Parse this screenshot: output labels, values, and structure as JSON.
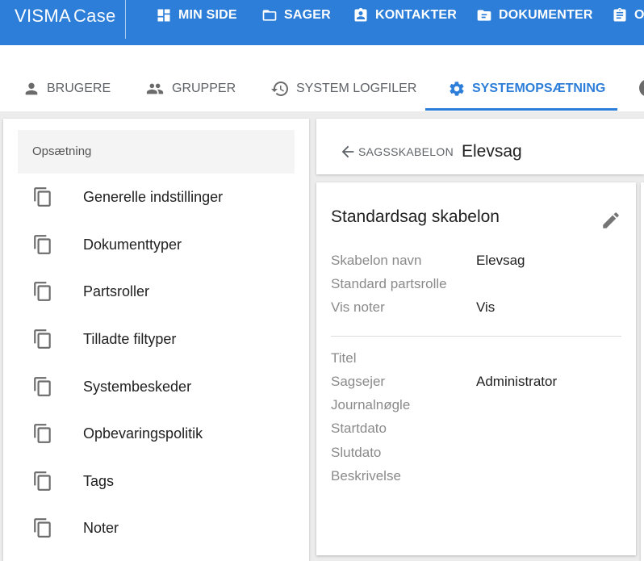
{
  "app": {
    "brand": "VISMA",
    "product": "Case"
  },
  "topnav": [
    {
      "id": "min-side",
      "label": "MIN SIDE",
      "icon": "dashboard-icon"
    },
    {
      "id": "sager",
      "label": "SAGER",
      "icon": "folder-icon"
    },
    {
      "id": "kontakter",
      "label": "KONTAKTER",
      "icon": "contact-card-icon"
    },
    {
      "id": "dokumenter",
      "label": "DOKUMENTER",
      "icon": "document-folder-icon"
    },
    {
      "id": "o",
      "label": "O",
      "icon": "clipboard-icon"
    }
  ],
  "tabs": [
    {
      "id": "brugere",
      "label": "BRUGERE",
      "icon": "person-icon",
      "active": false
    },
    {
      "id": "grupper",
      "label": "GRUPPER",
      "icon": "group-icon",
      "active": false
    },
    {
      "id": "system-logfiler",
      "label": "SYSTEM LOGFILER",
      "icon": "history-icon",
      "active": false
    },
    {
      "id": "systemopsaetning",
      "label": "SYSTEMOPSÆTNING",
      "icon": "gear-icon",
      "active": true
    }
  ],
  "sidebar": {
    "header": "Opsætning",
    "items": [
      {
        "label": "Generelle indstillinger",
        "icon": "copy-icon"
      },
      {
        "label": "Dokumenttyper",
        "icon": "copy-icon"
      },
      {
        "label": "Partsroller",
        "icon": "copy-icon"
      },
      {
        "label": "Tilladte filtyper",
        "icon": "copy-icon"
      },
      {
        "label": "Systembeskeder",
        "icon": "copy-icon"
      },
      {
        "label": "Opbevaringspolitik",
        "icon": "copy-icon"
      },
      {
        "label": "Tags",
        "icon": "copy-icon"
      },
      {
        "label": "Noter",
        "icon": "copy-icon"
      }
    ]
  },
  "header": {
    "back_label": "SAGSSKABELON",
    "title": "Elevsag"
  },
  "detail": {
    "title": "Standardsag skabelon",
    "group1": [
      {
        "label": "Skabelon navn",
        "value": "Elevsag"
      },
      {
        "label": "Standard partsrolle",
        "value": ""
      },
      {
        "label": "Vis noter",
        "value": "Vis"
      }
    ],
    "group2": [
      {
        "label": "Titel",
        "value": ""
      },
      {
        "label": "Sagsejer",
        "value": "Administrator"
      },
      {
        "label": "Journalnøgle",
        "value": ""
      },
      {
        "label": "Startdato",
        "value": ""
      },
      {
        "label": "Slutdato",
        "value": ""
      },
      {
        "label": "Beskrivelse",
        "value": ""
      }
    ]
  },
  "colors": {
    "primary": "#2d7ed8",
    "background": "#ececec",
    "muted_text": "#8a8a8a"
  }
}
